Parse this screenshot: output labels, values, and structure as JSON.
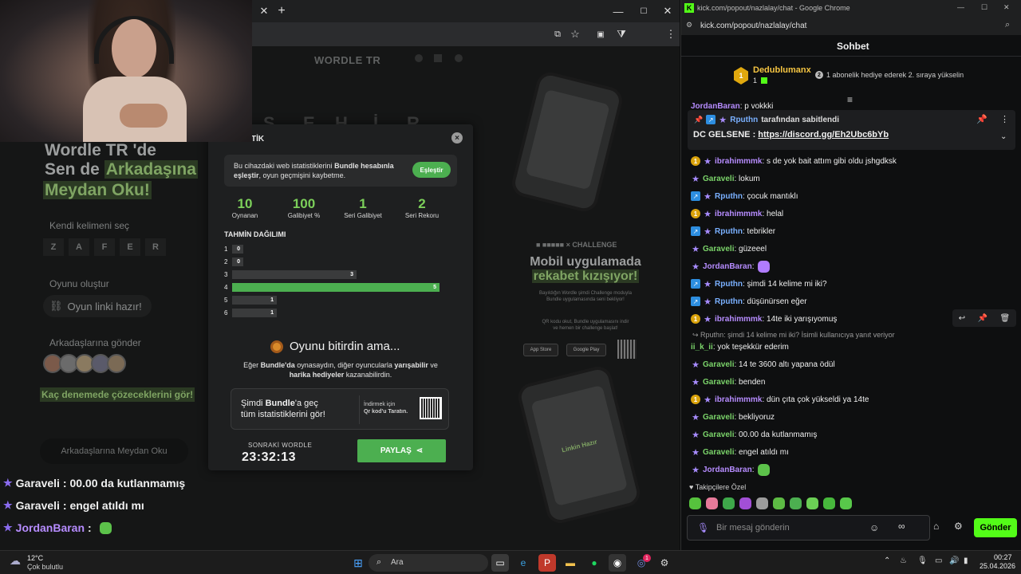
{
  "left_browser": {
    "wordle": {
      "site_title": "WORDLE TR",
      "bg_letters": [
        "Ş",
        "E",
        "H",
        "İ",
        "R"
      ],
      "hero_line1": "Wordle TR 'de",
      "hero_line2_plain": "Sen de",
      "hero_line2_hl": "Arkadaşına",
      "hero_line3_hl": "Meydan Oku!",
      "step1_label": "Kendi kelimeni seç",
      "step1_tiles": [
        "Z",
        "A",
        "F",
        "E",
        "R"
      ],
      "step2_label": "Oyunu oluştur",
      "step2_pill": "Oyun linki hazır!",
      "step3_label": "Arkadaşlarına gönder",
      "step3_link": "Kaç denemede çözeceklerini gör!",
      "cta_button": "Arkadaşlarına Meydan Oku"
    },
    "modal": {
      "title": "TİK",
      "sync_text_1": "Bu cihazdaki web istatistiklerini",
      "sync_text_bold": "Bundle hesabınla eşleştir",
      "sync_text_2": ", oyun geçmişini kaybetme.",
      "sync_button": "Eşleştir",
      "stats": [
        {
          "value": "10",
          "label": "Oynanan"
        },
        {
          "value": "100",
          "label": "Galibiyet %"
        },
        {
          "value": "1",
          "label": "Seri Galibiyet"
        },
        {
          "value": "2",
          "label": "Seri Rekoru"
        }
      ],
      "dist_title": "TAHMİN DAĞILIMI",
      "distribution": [
        {
          "guess": "1",
          "count": "0",
          "highlight": false
        },
        {
          "guess": "2",
          "count": "0",
          "highlight": false
        },
        {
          "guess": "3",
          "count": "3",
          "highlight": false
        },
        {
          "guess": "4",
          "count": "5",
          "highlight": true
        },
        {
          "guess": "5",
          "count": "1",
          "highlight": false
        },
        {
          "guess": "6",
          "count": "1",
          "highlight": false
        }
      ],
      "end_title": "Oyunu bitirdin ama...",
      "end_sub_1": "Eğer",
      "end_sub_b1": "Bundle'da",
      "end_sub_2": "oynasaydın, diğer oyuncularla",
      "end_sub_b2": "yarışabilir",
      "end_sub_3": "ve",
      "end_sub_b3": "harika hediyeler",
      "end_sub_4": "kazanabilirdin.",
      "bundle_main_1": "Şimdi",
      "bundle_main_b": "Bundle",
      "bundle_main_2": "'a geç",
      "bundle_main_3": "tüm istatistiklerini gör!",
      "bundle_side_1": "İndirmek için",
      "bundle_side_2": "Qr kod'u Taratın.",
      "next_label": "SONRAKİ WORDLE",
      "timer": "23:32:13",
      "share_button": "PAYLAŞ"
    },
    "promo": {
      "challenge_tag": "× CHALLENGE",
      "title_1": "Mobil uygulamada",
      "title_2": "rekabet kızışıyor!",
      "sub_1": "Bayıldığın Wordle şimdi Challenge moduyla",
      "sub_2": "Bundle uygulamasında seni bekliyor!",
      "sub_3": "QR kodu okut, Bundle uygulamasını indir",
      "sub_4": "ve hemen bir challenge başlat!",
      "app_store": "App Store",
      "google_play": "Google Play",
      "phone_screen_label": "Linkin Hazır"
    },
    "overlay_chat": [
      {
        "user": "Garaveli",
        "text": ": 00.00 da kutlanmamış",
        "color": "white"
      },
      {
        "user": "Garaveli",
        "text": ": engel atıldı mı",
        "color": "white"
      },
      {
        "user": "JordanBaran",
        "text": " :",
        "color": "purple"
      }
    ]
  },
  "right_browser": {
    "window_title": "kick.com/popout/nazlalay/chat - Google Chrome",
    "url": "kick.com/popout/nazlalay/chat",
    "chat_header": "Sohbet",
    "top_gifter": {
      "name": "Dedublumanx",
      "rank": "1",
      "count": "1",
      "message": "1 abonelik hediye ederek 2. sıraya yükselin"
    },
    "partial_line": {
      "user": "JordanBaran",
      "text": ": p vokkki"
    },
    "pinned": {
      "by_user": "Rputhn",
      "by_text": "tarafından sabitlendi",
      "prefix": "DC GELSENE :",
      "link": "https://discord.gg/Eh2Ubc6bYb"
    },
    "messages": [
      {
        "badge": "gold",
        "user": "ibrahimmmk",
        "color": "purple",
        "text": ": s de yok bait attım gibi oldu jshgdksk"
      },
      {
        "badge": "star",
        "user": "Garaveli",
        "color": "green",
        "text": ": lokum"
      },
      {
        "badge": "blue",
        "user": "Rputhn",
        "color": "blue",
        "text": ": çocuk mantıklı"
      },
      {
        "badge": "gold",
        "user": "ibrahimmmk",
        "color": "purple",
        "text": ": helal"
      },
      {
        "badge": "blue",
        "user": "Rputhn",
        "color": "blue",
        "text": ": tebrikler"
      },
      {
        "badge": "star",
        "user": "Garaveli",
        "color": "green",
        "text": ": güzeeel"
      },
      {
        "badge": "star",
        "user": "JordanBaran",
        "color": "purple",
        "text": ":"
      },
      {
        "badge": "blue",
        "user": "Rputhn",
        "color": "blue",
        "text": ": şimdi 14 kelime mi iki?"
      },
      {
        "badge": "blue",
        "user": "Rputhn",
        "color": "blue",
        "text": ": düşünürsen eğer"
      },
      {
        "badge": "gold",
        "user": "ibrahimmmk",
        "color": "purple",
        "text": ": 14te iki yarışıyomuş"
      }
    ],
    "reply_ref": "Rputhn: şimdi 14 kelime mi iki? İsimli kullanıcıya yanıt veriyor",
    "messages_2": [
      {
        "badge": "none",
        "user": "ii_k_ii",
        "color": "green",
        "text": ": yok teşekkür ederim"
      },
      {
        "badge": "star",
        "user": "Garaveli",
        "color": "green",
        "text": ": 14 te 3600 altı yapana ödül"
      },
      {
        "badge": "star",
        "user": "Garaveli",
        "color": "green",
        "text": ": benden"
      },
      {
        "badge": "gold",
        "user": "ibrahimmmk",
        "color": "purple",
        "text": ": dün çıta çok yükseldi ya 14te"
      },
      {
        "badge": "star",
        "user": "Garaveli",
        "color": "green",
        "text": ": bekliyoruz"
      },
      {
        "badge": "star",
        "user": "Garaveli",
        "color": "green",
        "text": ": 00.00 da kutlanmamış"
      },
      {
        "badge": "star",
        "user": "Garaveli",
        "color": "green",
        "text": ": engel atıldı mı"
      },
      {
        "badge": "star",
        "user": "JordanBaran",
        "color": "purple",
        "text": ":"
      }
    ],
    "emote_section": "Takipçilere Özel",
    "input_placeholder": "Bir mesaj gönderin",
    "send_button": "Gönder"
  },
  "taskbar": {
    "weather_temp": "12°C",
    "weather_desc": "Çok bulutlu",
    "search_placeholder": "Ara",
    "time": "00:27",
    "date": "25.04.2026",
    "discord_badge": "1"
  },
  "colors": {
    "accent_green": "#4caf50",
    "kick_green": "#53fc18",
    "username_purple": "#b68cff",
    "username_green": "#7bd46a",
    "username_blue": "#7ab0ff"
  }
}
